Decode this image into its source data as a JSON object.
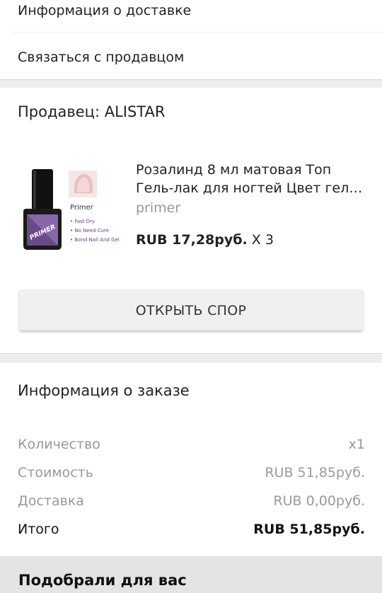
{
  "links": {
    "delivery_info": "Информация о доставке",
    "contact_seller": "Связаться с продавцом"
  },
  "seller": {
    "title": "Продавец: ALISTAR",
    "product": {
      "title_line1": "Розалинд 8 мл матовая Топ",
      "title_line2": "Гель-лак для ногтей Цвет гель …",
      "variant": "primer",
      "price": "RUB 17,28руб.",
      "quantity": "X 3",
      "image": {
        "label": "Primer",
        "bullets": [
          "Fast Dry",
          "No Need Cure",
          "Bond Nail And Gel"
        ],
        "bottle_text": "PRIMER"
      }
    },
    "dispute_button": "ОТКРЫТЬ СПОР"
  },
  "order": {
    "title": "Информация о заказе",
    "rows": [
      {
        "label": "Количество",
        "value": "x1"
      },
      {
        "label": "Стоимость",
        "value": "RUB 51,85руб."
      },
      {
        "label": "Доставка",
        "value": "RUB 0,00руб."
      },
      {
        "label": "Итого",
        "value": "RUB 51,85руб."
      }
    ]
  },
  "recommendations": {
    "title": "Подобрали для вас"
  },
  "colors": {
    "background": "#ededed",
    "card": "#ffffff",
    "muted_text": "#999999",
    "button": "#f0f0f0"
  }
}
